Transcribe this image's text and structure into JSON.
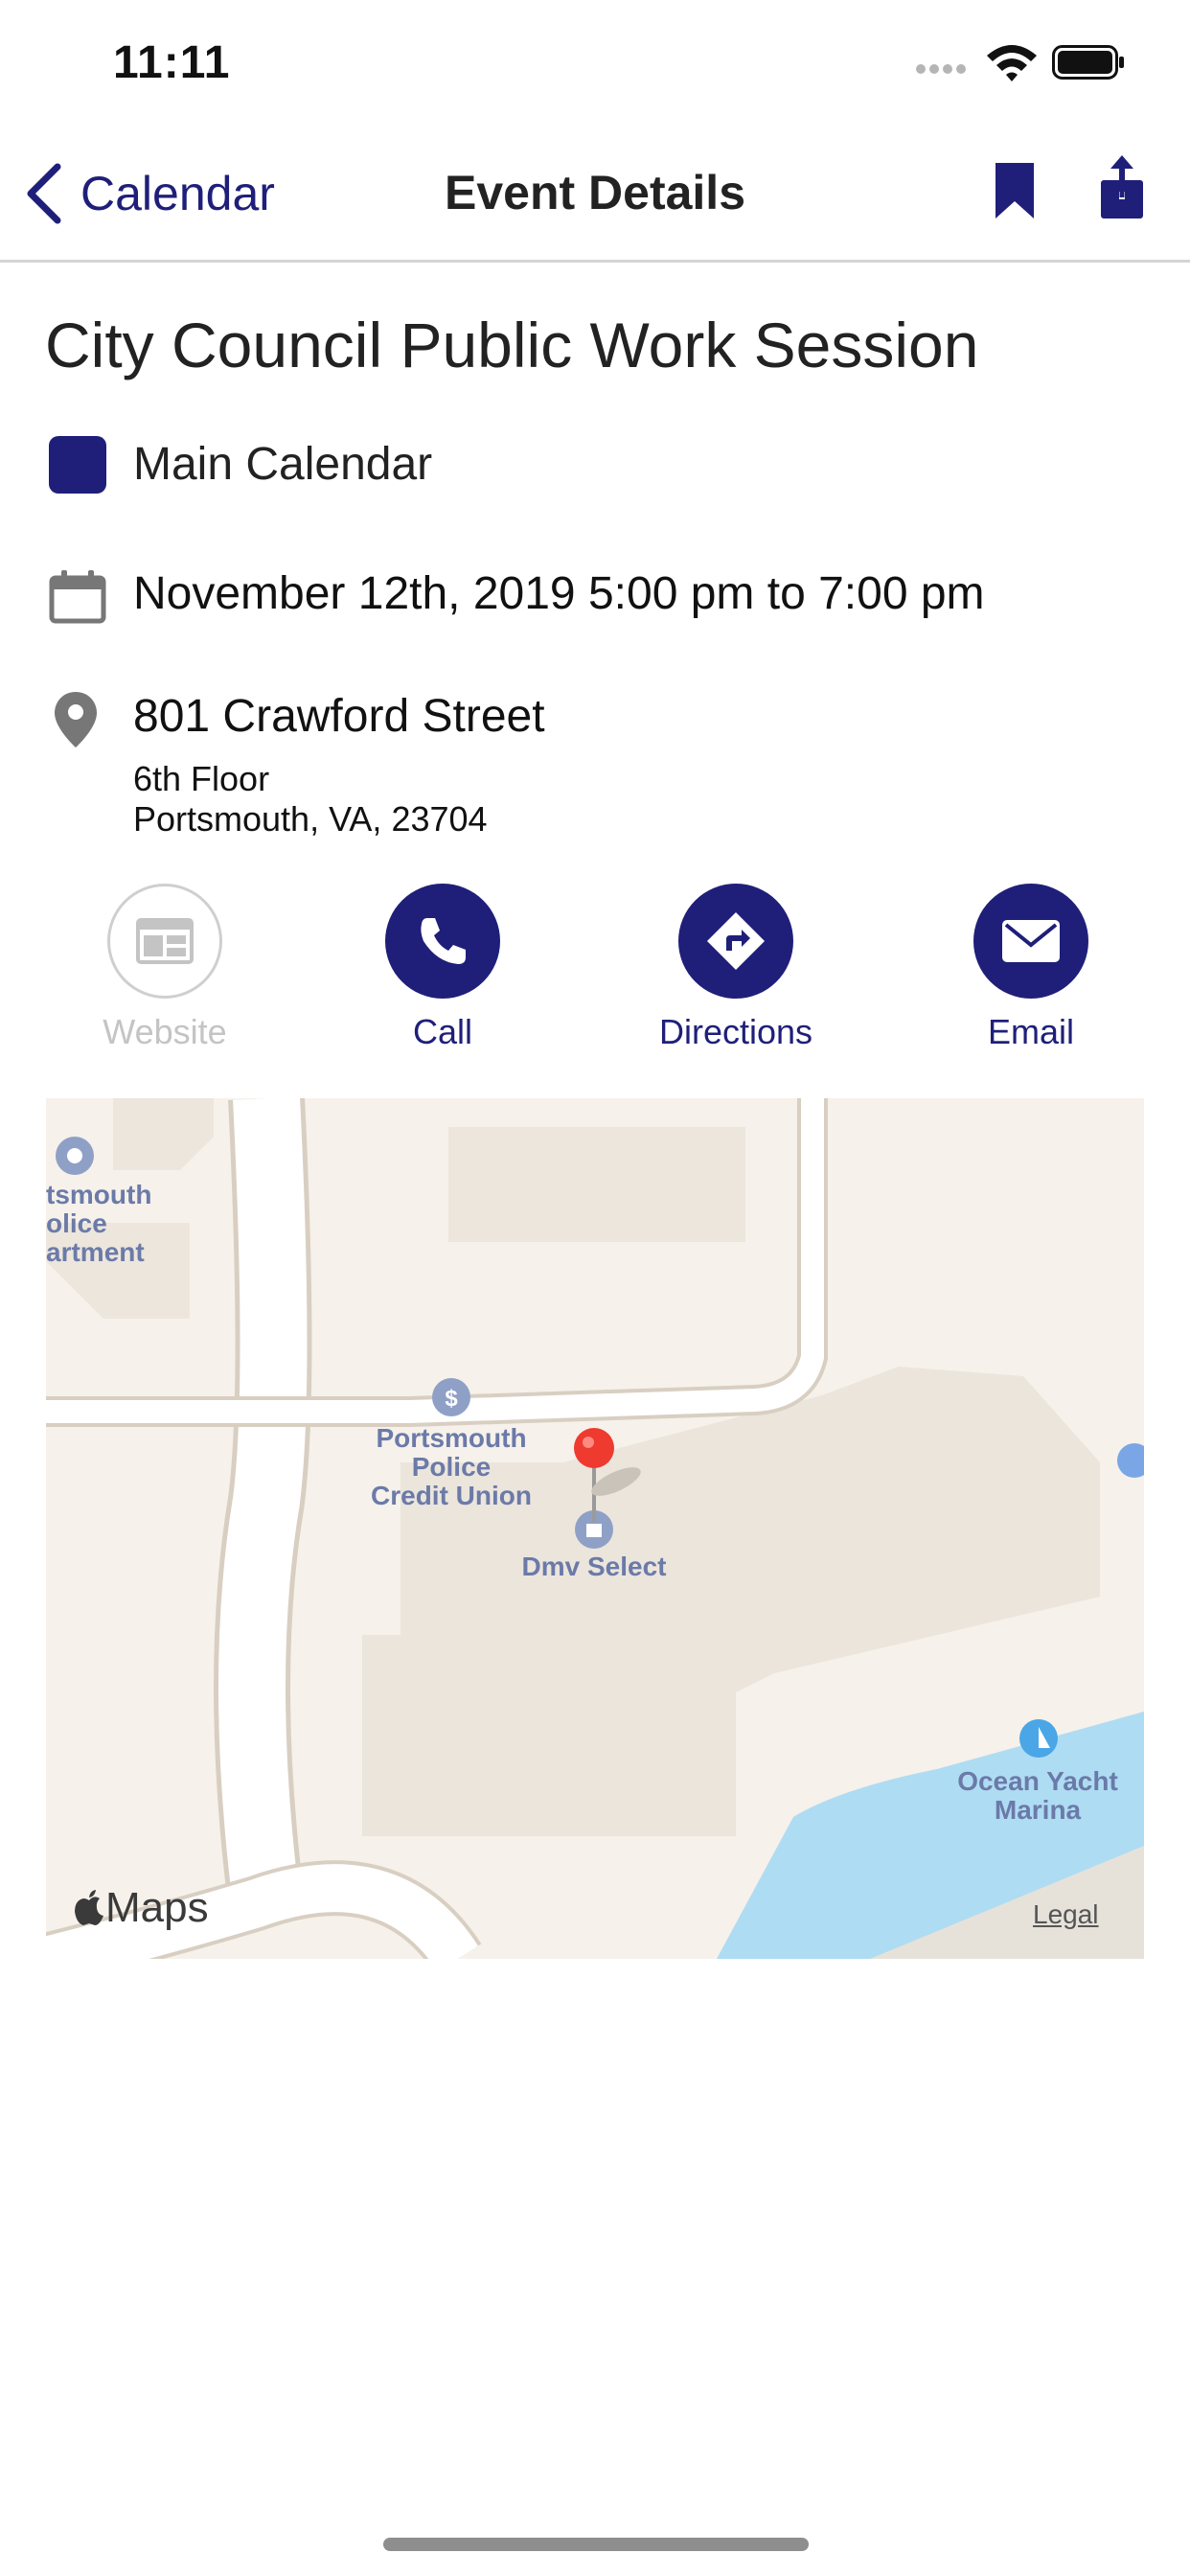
{
  "status_bar": {
    "time": "11:11"
  },
  "nav": {
    "back_label": "Calendar",
    "title": "Event Details"
  },
  "event": {
    "title": "City Council Public Work Session",
    "calendar_name": "Main Calendar",
    "calendar_color": "#1f1f7a",
    "datetime": "November 12th, 2019 5:00 pm to 7:00 pm",
    "address": {
      "line1": "801 Crawford Street",
      "line2": "6th Floor",
      "line3": "Portsmouth, VA, 23704"
    }
  },
  "actions": [
    {
      "label": "Website",
      "icon": "website-icon",
      "enabled": false
    },
    {
      "label": "Call",
      "icon": "phone-icon",
      "enabled": true
    },
    {
      "label": "Directions",
      "icon": "directions-icon",
      "enabled": true
    },
    {
      "label": "Email",
      "icon": "mail-icon",
      "enabled": true
    }
  ],
  "map": {
    "pois": [
      {
        "label": "tsmouth\nolice\nartment"
      },
      {
        "label": "Portsmouth\nPolice\nCredit Union"
      },
      {
        "label": "Dmv Select"
      },
      {
        "label": "Ocean Yacht\nMarina"
      }
    ],
    "attribution": "Maps",
    "legal": "Legal"
  },
  "colors": {
    "accent": "#1f1f7a",
    "disabled": "#c4c4c4"
  }
}
